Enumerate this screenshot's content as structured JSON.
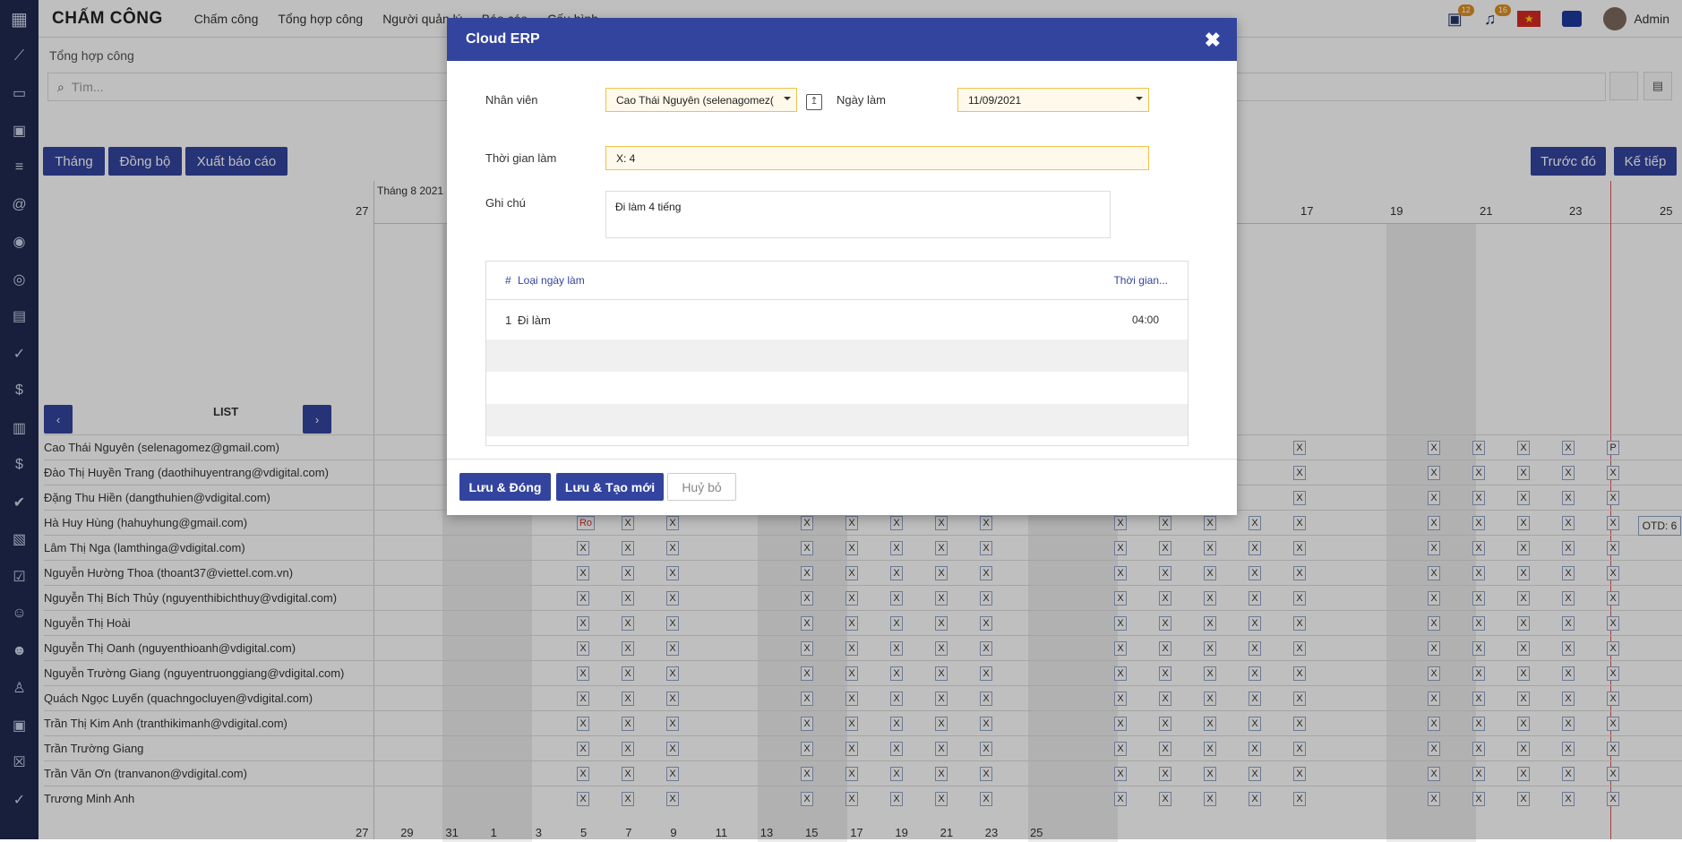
{
  "app": {
    "title": "CHẤM CÔNG"
  },
  "nav": [
    "Chấm công",
    "Tổng hợp công",
    "Người quản lý",
    "Báo cáo",
    "Cấu hình"
  ],
  "topbar": {
    "calendar_badge": "12",
    "bell_badge": "16",
    "user": "Admin"
  },
  "breadcrumb": "Tổng hợp công",
  "search": {
    "placeholder": "Tìm..."
  },
  "toolbar": {
    "month": "Tháng",
    "sync": "Đồng bộ",
    "export": "Xuất báo cáo",
    "prev": "Trước đó",
    "next": "Kế tiếp"
  },
  "calendar": {
    "month_label": "Tháng 8 2021",
    "list_label": "LIST",
    "prev_label": "‹",
    "next_label": "›",
    "days_top": [
      "27",
      "17",
      "19",
      "21",
      "23",
      "25"
    ],
    "days_bottom": [
      "27",
      "29",
      "31",
      "1",
      "3",
      "5",
      "7",
      "9",
      "11",
      "13",
      "15",
      "17",
      "19",
      "21",
      "23",
      "25"
    ],
    "otd": "OTD: 6",
    "employees": [
      "Cao Thái Nguyên (selenagomez@gmail.com)",
      "Đào Thị Huyền Trang (daothihuyentrang@vdigital.com)",
      "Đặng Thu Hiền (dangthuhien@vdigital.com)",
      "Hà Huy Hùng (hahuyhung@gmail.com)",
      "Lâm Thị Nga (lamthinga@vdigital.com)",
      "Nguyễn Hường Thoa (thoant37@viettel.com.vn)",
      "Nguyễn Thị Bích Thủy (nguyenthibichthuy@vdigital.com)",
      "Nguyễn Thị Hoài",
      "Nguyễn Thị Oanh (nguyenthioanh@vdigital.com)",
      "Nguyễn Trường Giang (nguyentruonggiang@vdigital.com)",
      "Quách Ngọc Luyến (quachngocluyen@vdigital.com)",
      "Trần Thị Kim Anh (tranthikimanh@vdigital.com)",
      "Trần Trường Giang",
      "Trần Văn Ơn (tranvanon@vdigital.com)",
      "Trương Minh Anh"
    ],
    "cell_mark": "X",
    "p_mark": "P",
    "ro_mark": "Ro"
  },
  "modal": {
    "title": "Cloud ERP",
    "employee_label": "Nhân viên",
    "employee_value": "Cao Thái Nguyên (selenagomez(",
    "date_label": "Ngày làm",
    "date_value": "11/09/2021",
    "time_label": "Thời gian làm",
    "time_value": "X: 4",
    "note_label": "Ghi chú",
    "note_value": "Đi làm 4 tiếng",
    "table": {
      "col_num": "#",
      "col_type": "Loại ngày làm",
      "col_time": "Thời gian...",
      "rows": [
        {
          "num": "1",
          "type": "Đi làm",
          "time": "04:00"
        }
      ]
    },
    "save_close": "Lưu & Đóng",
    "save_new": "Lưu & Tạo mới",
    "cancel": "Huỷ bỏ"
  }
}
